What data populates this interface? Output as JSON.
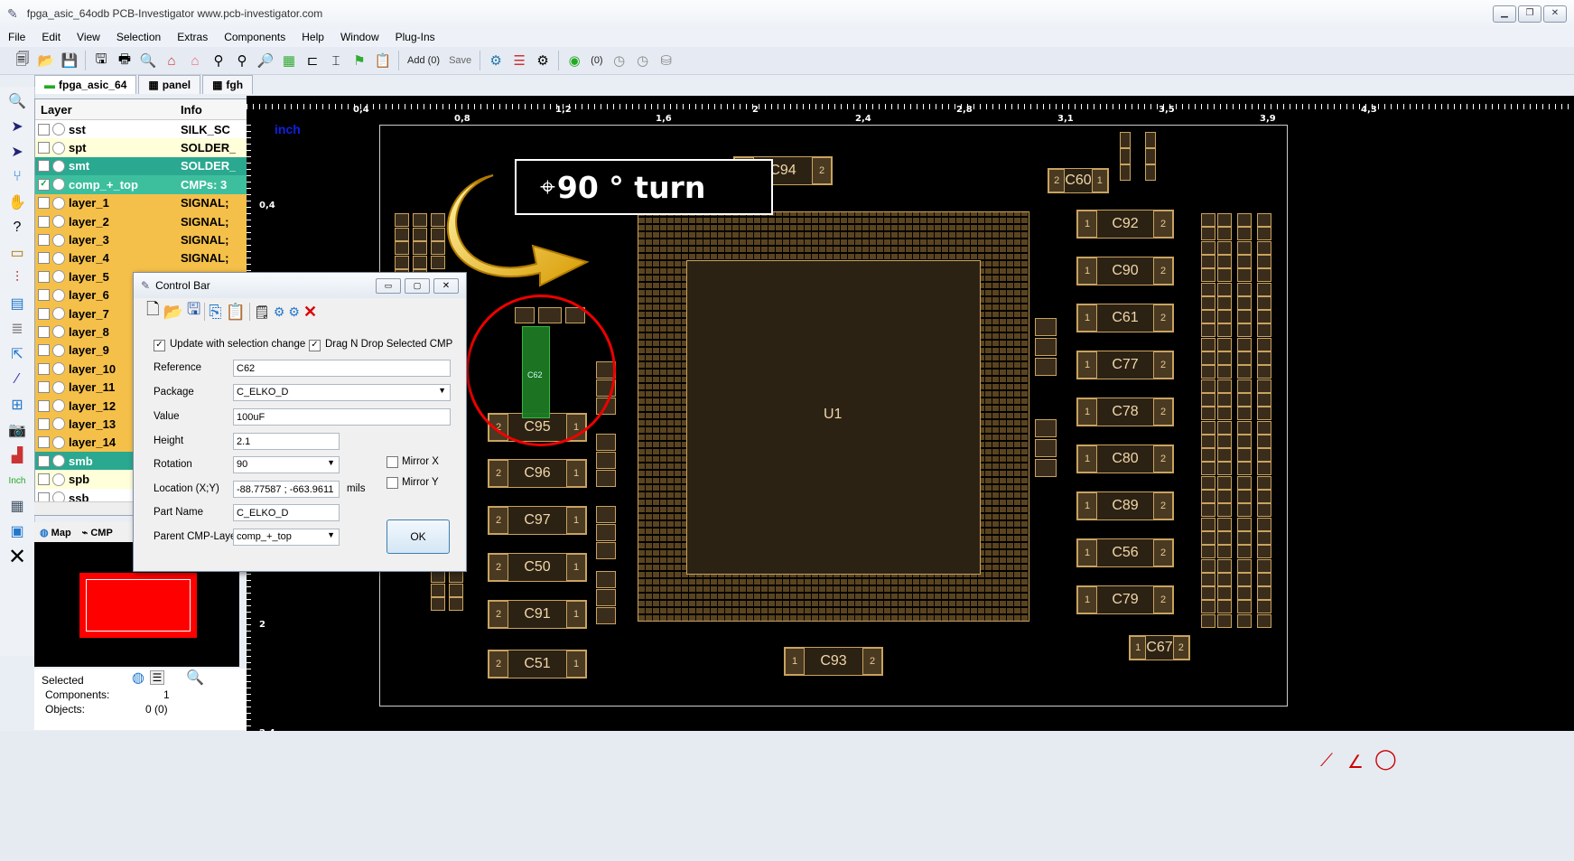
{
  "titlebar": {
    "app_title": "fpga_asic_64odb   PCB-Investigator   www.pcb-investigator.com"
  },
  "menu": [
    "File",
    "Edit",
    "View",
    "Selection",
    "Extras",
    "Components",
    "Help",
    "Window",
    "Plug-Ins"
  ],
  "toolbar": {
    "add_label": "Add (0)",
    "save_label": "Save",
    "count_label": "(0)"
  },
  "tabs": [
    {
      "label": "fpga_asic_64"
    },
    {
      "label": "panel"
    },
    {
      "label": "fgh"
    }
  ],
  "layers": {
    "header_layer": "Layer",
    "header_info": "Info",
    "rows": [
      {
        "name": "sst",
        "info": "SILK_SC",
        "bg": "#ffffff",
        "checked": false
      },
      {
        "name": "spt",
        "info": "SOLDER_",
        "bg": "#ffffd9",
        "checked": false
      },
      {
        "name": "smt",
        "info": "SOLDER_",
        "bg": "#2aa890",
        "checked": false
      },
      {
        "name": "comp_+_top",
        "info": "CMPs: 3",
        "bg": "#3dbf9e",
        "checked": true
      },
      {
        "name": "layer_1",
        "info": "SIGNAL;",
        "bg": "#f5c04a",
        "checked": false
      },
      {
        "name": "layer_2",
        "info": "SIGNAL;",
        "bg": "#f5c04a",
        "checked": false
      },
      {
        "name": "layer_3",
        "info": "SIGNAL;",
        "bg": "#f5c04a",
        "checked": false
      },
      {
        "name": "layer_4",
        "info": "SIGNAL;",
        "bg": "#f5c04a",
        "checked": false
      },
      {
        "name": "layer_5",
        "info": "",
        "bg": "#f5c04a",
        "checked": false
      },
      {
        "name": "layer_6",
        "info": "",
        "bg": "#f5c04a",
        "checked": false
      },
      {
        "name": "layer_7",
        "info": "",
        "bg": "#f5c04a",
        "checked": false
      },
      {
        "name": "layer_8",
        "info": "",
        "bg": "#f5c04a",
        "checked": false
      },
      {
        "name": "layer_9",
        "info": "",
        "bg": "#f5c04a",
        "checked": false
      },
      {
        "name": "layer_10",
        "info": "",
        "bg": "#f5c04a",
        "checked": false
      },
      {
        "name": "layer_11",
        "info": "",
        "bg": "#f5c04a",
        "checked": false
      },
      {
        "name": "layer_12",
        "info": "",
        "bg": "#f5c04a",
        "checked": false
      },
      {
        "name": "layer_13",
        "info": "",
        "bg": "#f5c04a",
        "checked": false
      },
      {
        "name": "layer_14",
        "info": "",
        "bg": "#f5c04a",
        "checked": false
      },
      {
        "name": "smb",
        "info": "",
        "bg": "#2aa890",
        "checked": false
      },
      {
        "name": "spb",
        "info": "",
        "bg": "#ffffd9",
        "checked": false
      },
      {
        "name": "ssb",
        "info": "",
        "bg": "#ffffff",
        "checked": false
      }
    ]
  },
  "map_tabs": {
    "map": "Map",
    "cmp": "CMP"
  },
  "selection": {
    "title": "Selected",
    "components_label": "Components:",
    "components_value": "1",
    "objects_label": "Objects:",
    "objects_value": "0 (0)"
  },
  "left_tool": {
    "unit_label": "Inch"
  },
  "ruler": {
    "unit": "inch",
    "top_ticks": [
      "0,4",
      "0,8",
      "1,2",
      "1,6",
      "2",
      "2,4",
      "2,8",
      "3,1",
      "3,5",
      "3,9",
      "4,3"
    ],
    "left_ticks": [
      "0,4",
      "2",
      "2,4"
    ]
  },
  "annotation": {
    "turn_text": "90 ° turn"
  },
  "board": {
    "main_ic": "U1",
    "selected_cmp": "C62"
  },
  "dialog": {
    "title": "Control Bar",
    "update_label": "Update with selection change",
    "update_checked": true,
    "dragdrop_label": "Drag N Drop Selected CMP",
    "dragdrop_checked": true,
    "reference_label": "Reference",
    "reference_value": "C62",
    "package_label": "Package",
    "package_value": "C_ELKO_D",
    "value_label": "Value",
    "value_value": "100uF",
    "height_label": "Height",
    "height_value": "2.1",
    "rotation_label": "Rotation",
    "rotation_value": "90",
    "mirrorx_label": "Mirror X",
    "mirrory_label": "Mirror Y",
    "location_label": "Location (X;Y)",
    "location_value": "-88.77587 ; -663.9611",
    "location_unit": "mils",
    "partname_label": "Part Name",
    "partname_value": "C_ELKO_D",
    "parent_label": "Parent CMP-Layer",
    "parent_value": "comp_+_top",
    "ok_label": "OK"
  },
  "colors": {
    "pad_outline": "#c9a35f",
    "pad_fill": "#3b2d1b",
    "selected_green": "#1e7a24",
    "circle_red": "#e00000"
  }
}
